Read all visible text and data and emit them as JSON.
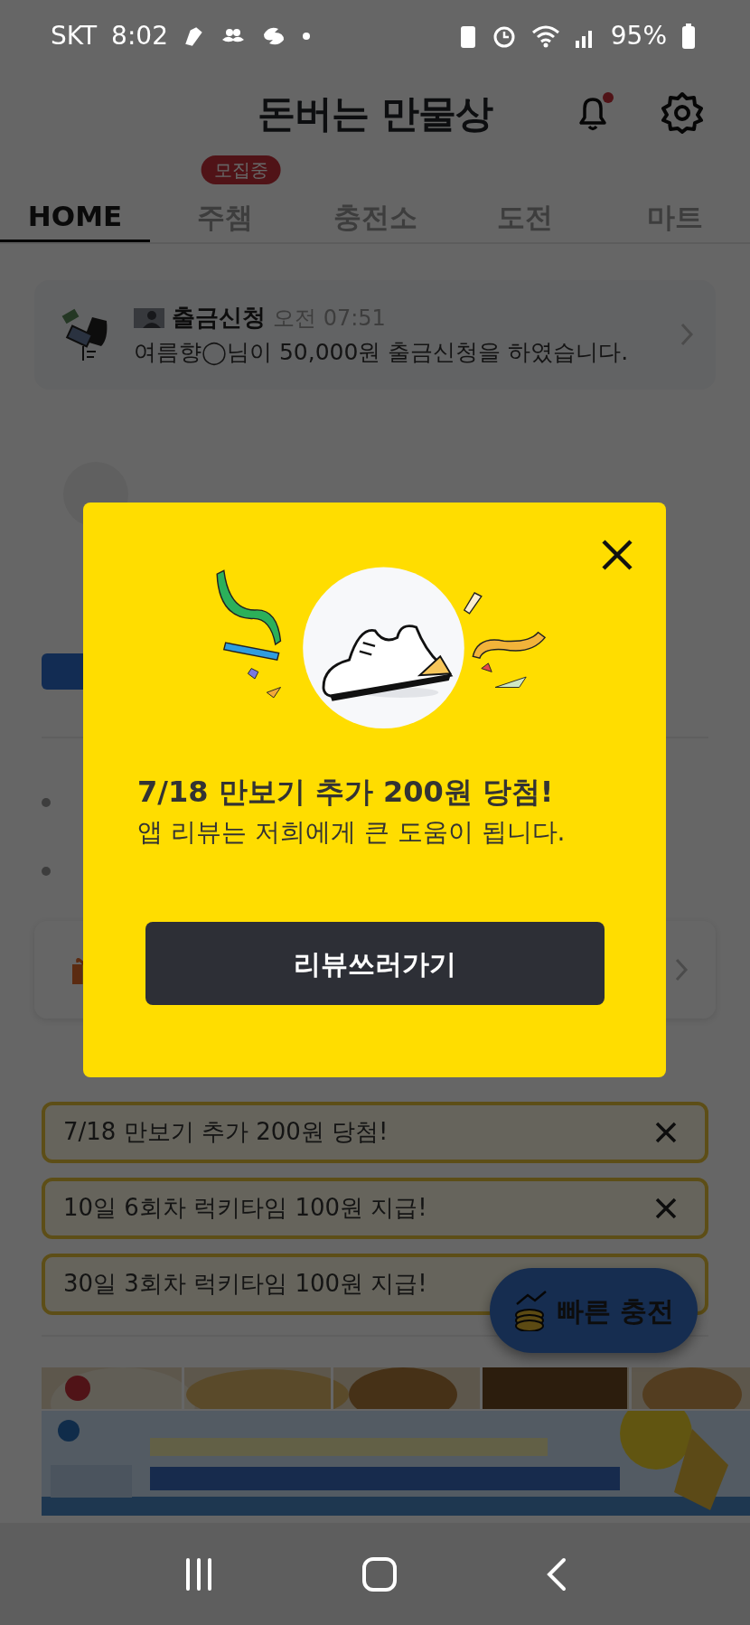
{
  "status_bar": {
    "carrier": "SKT",
    "time": "8:02",
    "battery": "95%"
  },
  "header": {
    "title": "돈버는 만물상",
    "notification_dot": true
  },
  "tabs": [
    {
      "label": "HOME",
      "selected": true
    },
    {
      "label": "주챔",
      "selected": false,
      "badge": "모집중"
    },
    {
      "label": "충전소",
      "selected": false
    },
    {
      "label": "도전",
      "selected": false
    },
    {
      "label": "마트",
      "selected": false
    }
  ],
  "notice": {
    "title": "출금신청",
    "time": "오전 07:51",
    "message": "여름향◯님이 50,000원 출금신청을 하였습니다."
  },
  "alerts": [
    {
      "text": "7/18 만보기 추가 200원 당첨!"
    },
    {
      "text": "10일 6회차 럭키타임 100원 지급!"
    },
    {
      "text": "30일 3회차 럭키타임 100원 지급!"
    }
  ],
  "fab": {
    "label": "빠른 충전"
  },
  "modal": {
    "title": "7/18 만보기 추가 200원 당첨!",
    "message": "앱 리뷰는 저희에게 큰 도움이 됩니다.",
    "button": "리뷰쓰러가기"
  }
}
